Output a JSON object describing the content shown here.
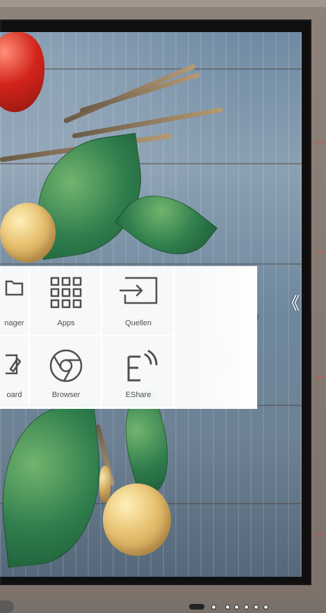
{
  "menu": {
    "items": [
      {
        "label": "nager",
        "icon": "folder-icon"
      },
      {
        "label": "Apps",
        "icon": "grid-icon"
      },
      {
        "label": "Quellen",
        "icon": "source-icon"
      },
      {
        "label": "oard",
        "icon": "whiteboard-icon"
      },
      {
        "label": "Browser",
        "icon": "chrome-icon"
      },
      {
        "label": "EShare",
        "icon": "eshare-icon"
      }
    ]
  },
  "navigation": {
    "chevron": "《"
  },
  "colors": {
    "panel": "#ffffff",
    "text": "#4e4e4e",
    "accent": "#d44d3c"
  }
}
